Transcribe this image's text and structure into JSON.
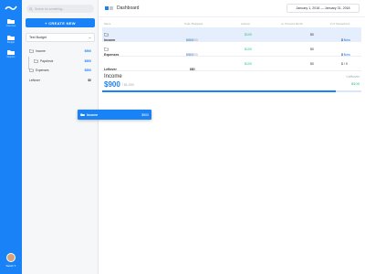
{
  "app": {
    "title": "Dashboard"
  },
  "rail": {
    "items": [
      {
        "label": "Overview",
        "icon": "folder-icon"
      },
      {
        "label": "Budget",
        "icon": "folder-icon"
      },
      {
        "label": "Reports",
        "icon": "folder-icon"
      }
    ],
    "user": "Sarah T."
  },
  "sidebar": {
    "search_placeholder": "Search for something...",
    "create_label": "+ CREATE NEW",
    "budget_name": "Test Budget",
    "groups": [
      {
        "name": "Income",
        "amount": "$900"
      },
      {
        "name": "Paycheck",
        "amount": "$900"
      },
      {
        "name": "Expenses",
        "amount": "$900"
      },
      {
        "name": "Leftover",
        "amount": "$0"
      }
    ]
  },
  "main": {
    "date_range": "January 1, 2018 — January 31, 2018",
    "columns": {
      "name": "Name",
      "budgeted": "Total / Budgeted",
      "leftover": "Leftover",
      "prev": "vs. Previous Month",
      "tx": "# of Transactions"
    },
    "rows": [
      {
        "name": "Income",
        "total": "$900",
        "budgeted": "/ $1,000",
        "leftover": "$100",
        "prev": "$0",
        "tx_count": "$ / ",
        "tx_new": "2 New"
      },
      {
        "name": "Expenses",
        "total": "$900",
        "budgeted": "/ $1,000",
        "leftover": "$100",
        "prev": "$0",
        "tx_count": "$ / ",
        "tx_new": "2 New"
      },
      {
        "name": "Leftover",
        "total": "$0",
        "budgeted": "/ $0",
        "leftover": "$100",
        "prev": "$0",
        "tx_count": "$ / 0",
        "tx_new": ""
      }
    ],
    "summary": {
      "name": "Income",
      "value": "$900",
      "of": "/ $1,000",
      "leftover_label": "Leftover",
      "leftover_value": "$100",
      "progress_fraction": 0.9
    }
  },
  "drag_ghost": {
    "name": "Income",
    "amount": "$900"
  },
  "colors": {
    "accent": "#1a82f7",
    "positive": "#2cbf78",
    "selected_row": "#e4eefc"
  }
}
